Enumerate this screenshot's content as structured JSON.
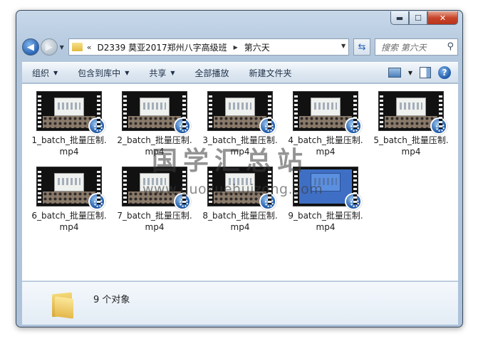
{
  "window": {
    "caption": {
      "minimize": "▬",
      "maximize": "☐",
      "close": "✕"
    }
  },
  "nav": {
    "back_icon": "◀",
    "forward_icon": "▶",
    "history_icon": "▼"
  },
  "address": {
    "chevron": "«",
    "segments": [
      "D2339 莫亚2017郑州八字高级班",
      "第六天"
    ],
    "separator": "▶",
    "dropdown": "▼"
  },
  "refresh_icon": "⇆",
  "search": {
    "placeholder": "搜索 第六天",
    "icon": "⚲"
  },
  "toolbar": {
    "organize": "组织",
    "include_library": "包含到库中",
    "share": "共享",
    "play_all": "全部播放",
    "new_folder": "新建文件夹",
    "dropdown_arrow": "▼",
    "help": "?"
  },
  "files": [
    {
      "name": "1_batch_批量压制.mp4"
    },
    {
      "name": "2_batch_批量压制.mp4"
    },
    {
      "name": "3_batch_批量压制.mp4"
    },
    {
      "name": "4_batch_批量压制.mp4"
    },
    {
      "name": "5_batch_批量压制.mp4"
    },
    {
      "name": "6_batch_批量压制.mp4"
    },
    {
      "name": "7_batch_批量压制.mp4"
    },
    {
      "name": "8_batch_批量压制.mp4"
    },
    {
      "name": "9_batch_批量压制.mp4"
    }
  ],
  "watermark": {
    "text": "国学汇总站",
    "url": "www.guoxuehuizong.com"
  },
  "details": {
    "count": "9 个对象"
  },
  "colors": {
    "chrome": "#b3c7dd",
    "accent": "#2a64b4",
    "close": "#c7452b"
  }
}
